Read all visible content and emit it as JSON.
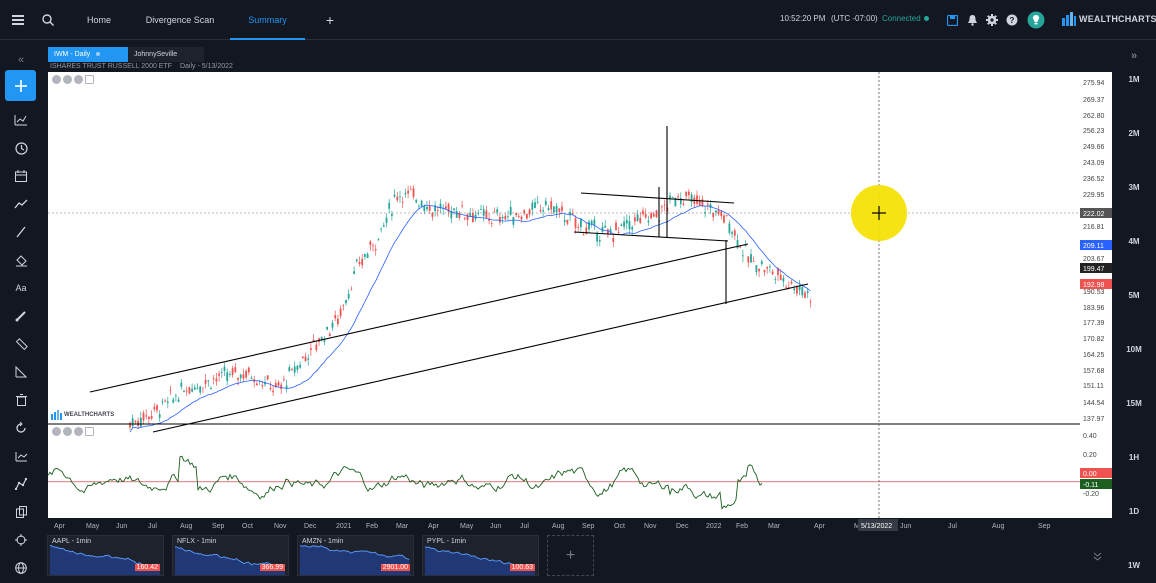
{
  "topbar": {
    "tabs": [
      {
        "label": "Home",
        "active": false
      },
      {
        "label": "Divergence Scan",
        "active": false
      },
      {
        "label": "Summary",
        "active": true
      }
    ],
    "time": "10:52:20 PM",
    "timezone": "(UTC -07:00)",
    "status": "Connected",
    "brand": "WEALTHCHARTS",
    "icons": [
      "menu-icon",
      "search-icon",
      "add-tab-icon",
      "save-icon",
      "bell-icon",
      "gear-icon",
      "help-icon",
      "lightbulb-icon"
    ]
  },
  "chart_header": {
    "symbol_tab": "IWM - Daily",
    "user_tab": "JohnnySeville",
    "title": "ISHARES TRUST RUSSELL 2000 ETF",
    "interval": "Daily",
    "date": "5/13/2022"
  },
  "price_axis": {
    "ticks": [
      "275.94",
      "269.37",
      "262.80",
      "256.23",
      "249.66",
      "243.09",
      "236.52",
      "229.95",
      "222.02",
      "216.81",
      "209.11",
      "203.67",
      "199.47",
      "192.98",
      "190.53",
      "183.96",
      "177.39",
      "170.82",
      "164.25",
      "157.68",
      "151.11",
      "144.54",
      "137.97"
    ],
    "crosshair_label": "222.02",
    "ma_label": "209.11",
    "ma2_label": "199.47",
    "last_label": "192.98"
  },
  "osc_axis": {
    "ticks": [
      "0.40",
      "0.20",
      "0.00",
      "-0.11",
      "-0.20"
    ],
    "zero_label": "0.00",
    "last_label": "-0.11"
  },
  "time_axis": {
    "ticks": [
      "Apr",
      "May",
      "Jun",
      "Jul",
      "Aug",
      "Sep",
      "Oct",
      "Nov",
      "Dec",
      "2021",
      "Feb",
      "Mar",
      "Apr",
      "May",
      "Jun",
      "Jul",
      "Aug",
      "Sep",
      "Oct",
      "Nov",
      "Dec",
      "2022",
      "Feb",
      "Mar",
      "Apr",
      "M",
      "Jun",
      "Jul",
      "Aug",
      "Sep"
    ],
    "crosshair_date": "5/13/2022"
  },
  "intervals": [
    "1M",
    "2M",
    "3M",
    "4M",
    "5M",
    "10M",
    "15M",
    "1H",
    "1D",
    "1W"
  ],
  "watermark": "WEALTHCHARTS",
  "minis": [
    {
      "label": "AAPL - 1min",
      "price": "160.42"
    },
    {
      "label": "NFLX - 1min",
      "price": "366.99"
    },
    {
      "label": "AMZN - 1min",
      "price": "2901.00"
    },
    {
      "label": "PYPL - 1min",
      "price": "100.63"
    }
  ],
  "mini_add": "+",
  "colors": {
    "accent": "#2196f3",
    "up": "#26a69a",
    "down": "#ef5350",
    "ma": "#2962ff",
    "osc": "#1b5e20"
  }
}
